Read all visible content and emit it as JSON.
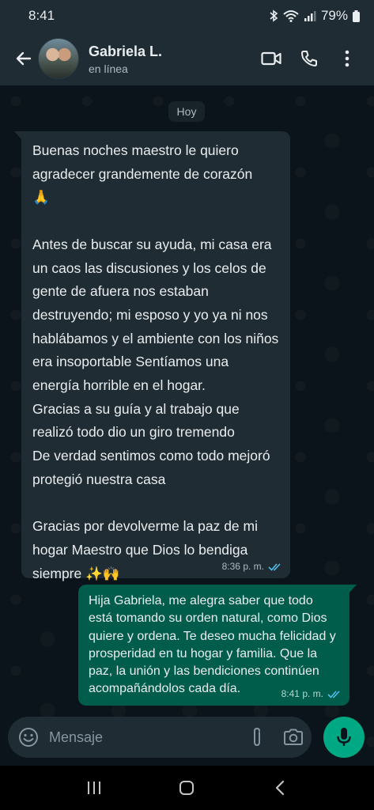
{
  "status_bar": {
    "time": "8:41",
    "battery": "79%"
  },
  "header": {
    "contact_name": "Gabriela L.",
    "contact_status": "en línea",
    "icons": [
      "back-arrow-icon",
      "video-call-icon",
      "phone-icon",
      "more-vertical-icon"
    ]
  },
  "chat": {
    "date_chip": "Hoy",
    "messages": [
      {
        "direction": "incoming",
        "text": "Buenas noches maestro le quiero agradecer grandemente de corazón\n🙏\n\nAntes de buscar su ayuda, mi casa era un caos las discusiones y los celos  de gente de afuera nos estaban destruyendo; mi esposo y yo ya ni nos hablábamos y el ambiente con los niños era insoportable  Sentíamos una energía horrible en el hogar.\nGracias a su guía y al trabajo que realizó todo dio un giro tremendo\nDe verdad sentimos como todo mejoró protegió nuestra casa\n\nGracias por devolverme la paz de mi hogar Maestro que Dios lo bendiga siempre ✨🙌",
        "time": "8:36 p. m."
      },
      {
        "direction": "outgoing",
        "text": "Hija Gabriela, me alegra saber que todo está tomando su orden natural, como Dios quiere y ordena. Te deseo mucha felicidad y prosperidad en tu hogar y familia. Que la paz, la unión y las bendiciones continúen acompañándolos cada día.",
        "time": "8:41 p. m."
      }
    ]
  },
  "input": {
    "placeholder": "Mensaje"
  },
  "colors": {
    "background": "#0b141a",
    "header": "#1f2c34",
    "incoming_bubble": "#202c33",
    "outgoing_bubble": "#005c4b",
    "accent": "#00a884",
    "read_ticks": "#53bdeb"
  }
}
